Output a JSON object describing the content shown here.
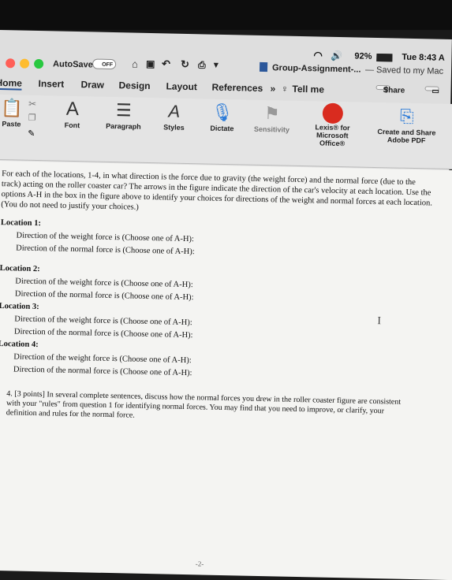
{
  "menubar": {
    "battery": "92%",
    "clock": "Tue 8:43 A"
  },
  "titlebar": {
    "autosave_label": "AutoSave",
    "autosave_state": "OFF",
    "doc_title": "Group-Assignment-...",
    "saved_status": "— Saved to my Mac",
    "colors": {
      "close": "#ff5f57",
      "min": "#febc2e",
      "max": "#28c840"
    }
  },
  "tabs": [
    "Home",
    "Insert",
    "Draw",
    "Design",
    "Layout",
    "References",
    "Tell me"
  ],
  "share_label": "Share",
  "ribbon": {
    "paste": "Paste",
    "font": "Font",
    "paragraph": "Paragraph",
    "styles": "Styles",
    "dictate": "Dictate",
    "sensitivity": "Sensitivity",
    "lexis": "Lexis® for Microsoft Office®",
    "create_share": "Create and Share Adobe PDF"
  },
  "document": {
    "intro": "For each of the locations, 1-4, in what direction is the force due to gravity (the weight force) and the normal force (due to the track) acting on the roller coaster car? The arrows in the figure indicate the direction of the car's velocity at each location. Use the options A-H in the box in the figure above to identify your choices for directions of the weight and normal forces at each location. (You do not need to justify your choices.)",
    "locations": [
      {
        "label": "Location 1:",
        "weight": "Direction of the weight force is (Choose one of A-H):",
        "normal": "Direction of the normal force is (Choose one of A-H):"
      },
      {
        "label": "Location 2:",
        "weight": "Direction of the weight force is (Choose one of A-H):",
        "normal": "Direction of the normal force is (Choose one of A-H):"
      },
      {
        "label": "Location 3:",
        "weight": "Direction of the weight force is (Choose one of A-H):",
        "normal": "Direction of the normal force is (Choose one of A-H):"
      },
      {
        "label": "Location 4:",
        "weight": "Direction of the weight force is (Choose one of A-H):",
        "normal": "Direction of the normal force is (Choose one of A-H):"
      }
    ],
    "question4": "4. [3 points] In several complete sentences, discuss how the normal forces you drew in the roller coaster figure are consistent with your \"rules\" from question 1 for identifying normal forces. You may find that you need to improve, or clarify, your definition and rules for the normal force.",
    "page_number": "-2-"
  }
}
